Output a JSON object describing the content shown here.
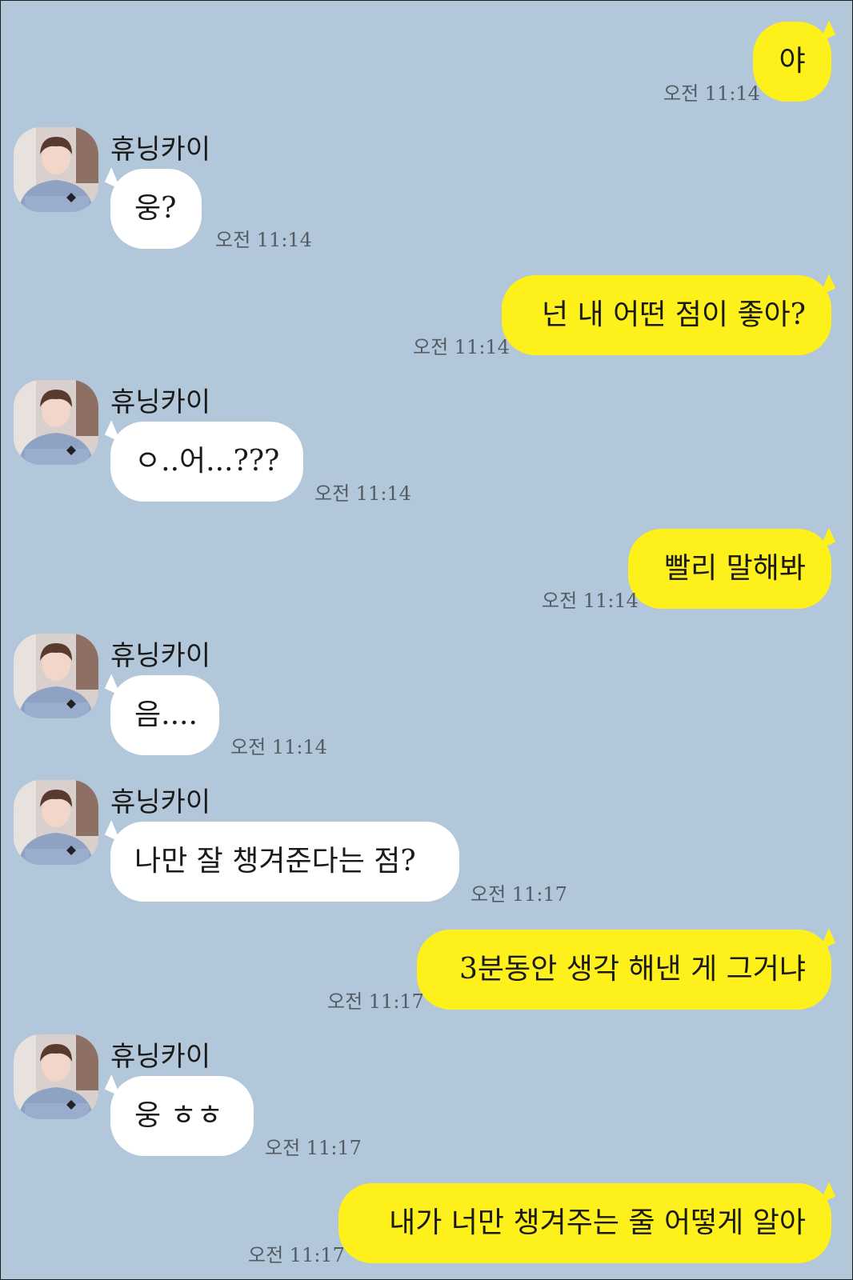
{
  "chat": {
    "friend_name": "휴닝카이",
    "messages": [
      {
        "text": "야",
        "time": "오전 11:14"
      },
      {
        "text": "웅?",
        "time": "오전 11:14"
      },
      {
        "text": "넌 내 어떤 점이 좋아?",
        "time": "오전 11:14"
      },
      {
        "text": "ㅇ..어...???",
        "time": "오전 11:14"
      },
      {
        "text": "빨리 말해봐",
        "time": "오전 11:14"
      },
      {
        "text": "음....",
        "time": "오전 11:14"
      },
      {
        "text": "나만 잘 챙겨준다는 점?",
        "time": "오전 11:17"
      },
      {
        "text": "3분동안 생각 해낸 게 그거냐",
        "time": "오전 11:17"
      },
      {
        "text": "웅 ㅎㅎ",
        "time": "오전 11:17"
      },
      {
        "text": "내가 너만 챙겨주는 줄 어떻게 알아",
        "time": "오전 11:17"
      }
    ]
  },
  "colors": {
    "background": "#b2c7da",
    "my_bubble": "#fef01b",
    "their_bubble": "#ffffff"
  },
  "icons": {
    "avatar": "profile-photo-avatar"
  }
}
